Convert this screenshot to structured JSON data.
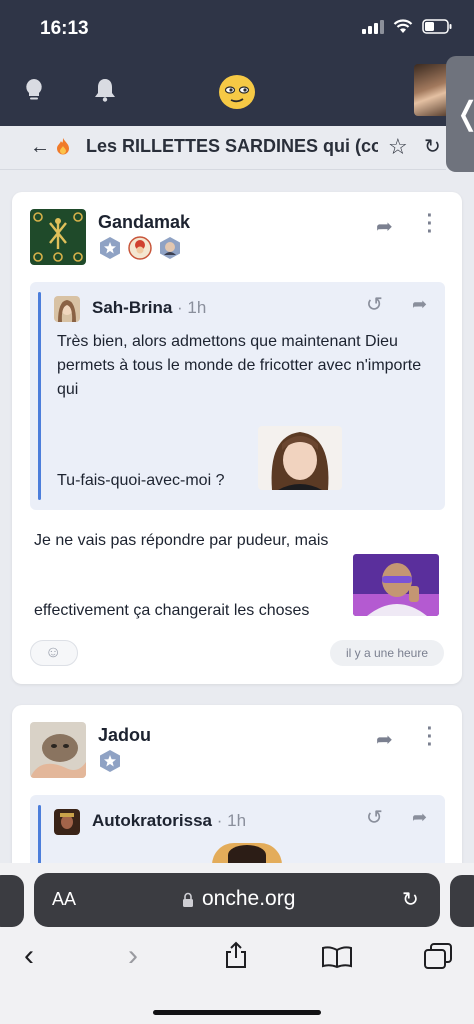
{
  "status": {
    "time": "16:13"
  },
  "header": {
    "icons": [
      "lightbulb-icon",
      "bell-icon",
      "onche-logo"
    ]
  },
  "topic": {
    "title": "Les RILLETTES SARDINES qui (com"
  },
  "posts": [
    {
      "author": "Gandamak",
      "quote": {
        "author": "Sah-Brina",
        "time": "1h",
        "text": "Très bien, alors admettons que maintenant Dieu permets à tous le monde de fricotter avec n'importe qui",
        "text2": "Tu-fais-quoi-avec-moi ?"
      },
      "reply_line1": "Je ne vais pas répondre par pudeur, mais",
      "reply_line2": "effectivement ça changerait les choses",
      "time": "il y a une heure"
    },
    {
      "author": "Jadou",
      "quote": {
        "author": "Autokratorissa",
        "time": "1h"
      }
    }
  ],
  "browser": {
    "aa_label": "AA",
    "url": "onche.org"
  },
  "colors": {
    "header_bg": "#2f3547",
    "quote_bg": "#ebeff8",
    "quote_bar": "#4c7edb"
  }
}
